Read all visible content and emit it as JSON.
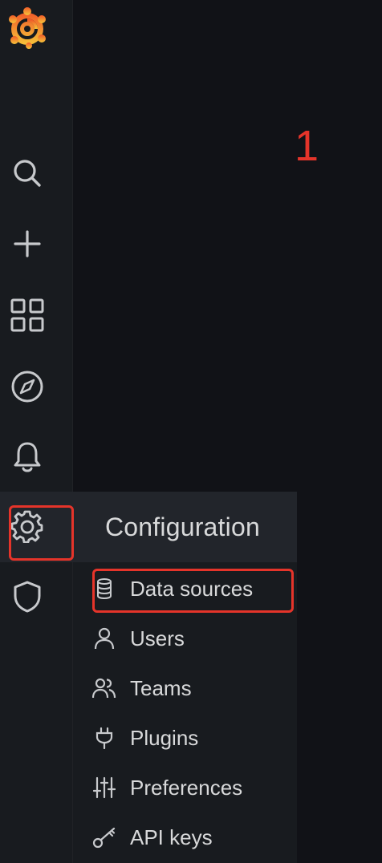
{
  "annotation": {
    "step_number": "1",
    "color": "#e5342a"
  },
  "sidebar": {
    "logo": "grafana-logo",
    "items": [
      {
        "name": "search",
        "icon": "search-icon"
      },
      {
        "name": "create",
        "icon": "plus-icon"
      },
      {
        "name": "dashboards",
        "icon": "apps-grid-icon"
      },
      {
        "name": "explore",
        "icon": "compass-icon"
      },
      {
        "name": "alerting",
        "icon": "bell-icon"
      },
      {
        "name": "configuration",
        "icon": "gear-icon",
        "active": true
      },
      {
        "name": "server-admin",
        "icon": "shield-icon"
      }
    ]
  },
  "config_menu": {
    "title": "Configuration",
    "items": [
      {
        "label": "Data sources",
        "icon": "database-icon",
        "highlighted": true
      },
      {
        "label": "Users",
        "icon": "user-icon"
      },
      {
        "label": "Teams",
        "icon": "users-icon"
      },
      {
        "label": "Plugins",
        "icon": "plug-icon"
      },
      {
        "label": "Preferences",
        "icon": "sliders-icon"
      },
      {
        "label": "API keys",
        "icon": "key-icon"
      }
    ]
  },
  "colors": {
    "background": "#111217",
    "sidebar": "#181b1f",
    "active": "#22252b",
    "text": "#d8d9da",
    "highlight": "#e5342a"
  }
}
